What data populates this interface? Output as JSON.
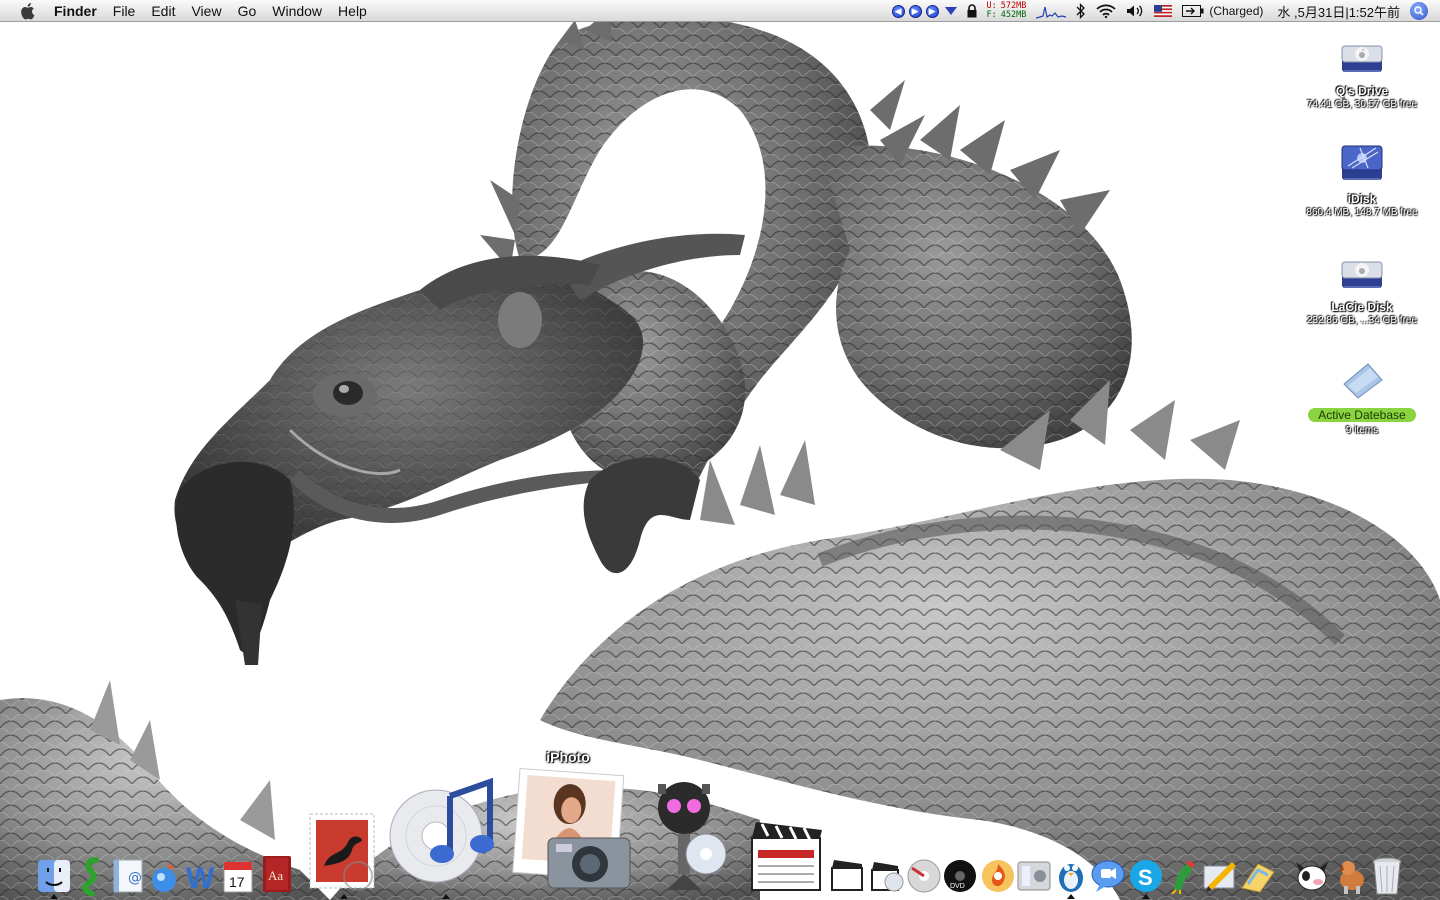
{
  "menubar": {
    "app_name": "Finder",
    "menus": [
      "File",
      "Edit",
      "View",
      "Go",
      "Window",
      "Help"
    ],
    "memory": {
      "used_label": "U:",
      "used_value": "572MB",
      "free_label": "F:",
      "free_value": "452MB"
    },
    "battery_status": "(Charged)",
    "clock": "水 ,5月31日|1:52午前"
  },
  "desktop": {
    "icons": [
      {
        "name": "Q's Drive",
        "info": "74.41 GB, 30.57 GB free",
        "icon": "hard-drive-icon"
      },
      {
        "name": "iDisk",
        "info": "860.4 MB, 148.7 MB free",
        "icon": "idisk-icon"
      },
      {
        "name": "LaCie Disk",
        "info": "232.86 GB, ...34 GB free",
        "icon": "external-drive-icon"
      },
      {
        "name": "Active Datebase",
        "info": "9 items",
        "icon": "folder-icon",
        "label_color": "#8ad441"
      }
    ]
  },
  "dock": {
    "hover_label": "iPhoto",
    "apps": [
      "finder-icon",
      "snake-app-icon",
      "address-book-icon",
      "globe-app-icon",
      "word-icon",
      "ical-icon",
      "dictionary-icon",
      "mail-stamp-icon",
      "itunes-icon",
      "iphoto-icon",
      "robot-app-icon",
      "final-cut-icon",
      "clapper-small-icon",
      "clapper-disc-icon",
      "dvd-studio-icon",
      "dvd-player-icon",
      "burn-disc-icon",
      "system-prefs-icon",
      "penguin-icon",
      "ichat-icon",
      "skype-icon",
      "parrot-icon",
      "pencil-app-icon",
      "folder-app-icon",
      "cow-app-icon",
      "dog-app-icon",
      "trash-icon"
    ]
  },
  "colors": {
    "menubar_bg": "#e8e8e8",
    "label_green": "#8ad441",
    "spotlight_blue": "#2d52c8"
  }
}
